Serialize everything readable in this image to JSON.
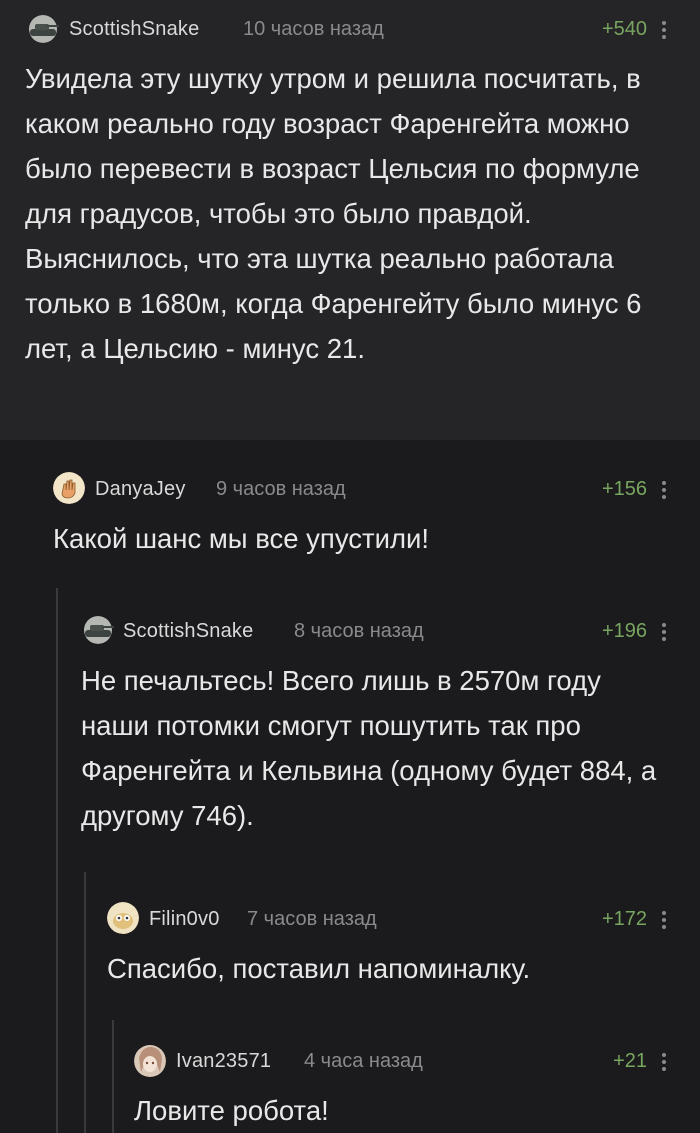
{
  "comments": [
    {
      "username": "ScottishSnake",
      "time": "10 часов назад",
      "rating": "+540",
      "avatar_icon": "tank-avatar",
      "text": "Увидела эту шутку утром и решила посчитать, в каком реально году возраст Фаренгейта можно было перевести в возраст Цельсия по формуле для градусов, чтобы это было правдой. Выяснилось, что эта шутка реально работала только в 1680м, когда Фаренгейту было минус 6 лет, а Цельсию - минус 21."
    },
    {
      "username": "DanyaJey",
      "time": "9 часов назад",
      "rating": "+156",
      "avatar_icon": "hand-avatar",
      "text": "Какой шанс мы все упустили!"
    },
    {
      "username": "ScottishSnake",
      "time": "8 часов назад",
      "rating": "+196",
      "avatar_icon": "tank-avatar",
      "text": "Не печальтесь! Всего лишь в 2570м году наши потомки смогут пошутить так про Фаренгейта и Кельвина (одному будет 884, а другому 746)."
    },
    {
      "username": "Filin0v0",
      "time": "7 часов назад",
      "rating": "+172",
      "avatar_icon": "owl-avatar",
      "text": "Спасибо, поставил напоминалку."
    },
    {
      "username": "Ivan23571",
      "time": "4 часа назад",
      "rating": "+21",
      "avatar_icon": "anime-avatar",
      "text": "Ловите робота!"
    }
  ],
  "colors": {
    "background": "#1b1b1d",
    "highlight_background": "#252528",
    "rating": "#78a55f",
    "meta_text": "#8a8a8c",
    "body_text": "#e8e8e8",
    "thread_line": "#3a3a3d"
  }
}
